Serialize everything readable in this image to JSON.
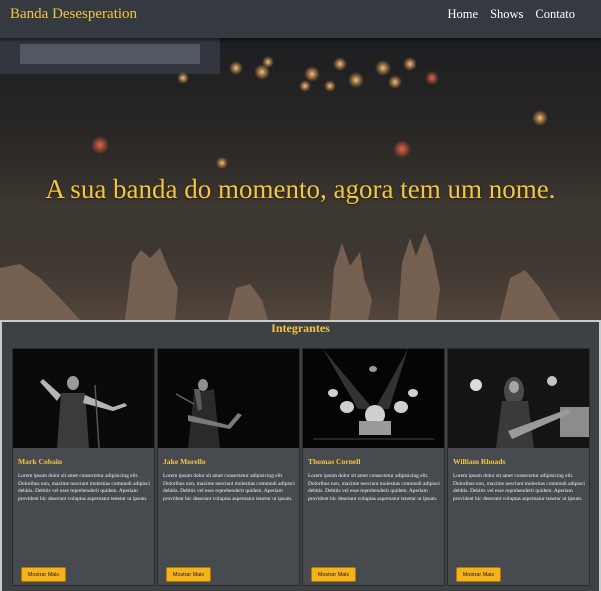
{
  "navbar": {
    "brand": "Banda Desesperation",
    "links": [
      "Home",
      "Shows",
      "Contato"
    ]
  },
  "hero": {
    "title": "A sua banda do momento, agora tem um nome."
  },
  "members": {
    "title": "Integrantes",
    "cards": [
      {
        "name": "Mark Cobain",
        "text": "Lorem ipsum dolor sit amet consectetur adipisicing elit. Doloribus non, maxime nesciunt molestias commodi adipisci debitis. Debitis vel esse reprehenderit quidem. Aperiam provident hic deserunt voluptas aspernatur tenetur ut ipsum.",
        "button": "Mostrar Mais"
      },
      {
        "name": "Jake Morello",
        "text": "Lorem ipsum dolor sit amet consectetur adipisicing elit. Doloribus non, maxime nesciunt molestias commodi adipisci debitis. Debitis vel esse reprehenderit quidem. Aperiam provident hic deserunt voluptas aspernatur tenetur ut ipsum.",
        "button": "Mostrar Mais"
      },
      {
        "name": "Thomas Cornell",
        "text": "Lorem ipsum dolor sit amet consectetur adipisicing elit. Doloribus non, maxime nesciunt molestias commodi adipisci debitis. Debitis vel esse reprehenderit quidem. Aperiam provident hic deserunt voluptas aspernatur tenetur ut ipsum.",
        "button": "Mostrar Mais"
      },
      {
        "name": "William Rhoads",
        "text": "Lorem ipsum dolor sit amet consectetur adipisicing elit. Doloribus non, maxime nesciunt molestias commodi adipisci debitis. Debitis vel esse reprehenderit quidem. Aperiam provident hic deserunt voluptas aspernatur tenetur ut ipsum.",
        "button": "Mostrar Mais"
      }
    ]
  },
  "colors": {
    "accent": "#f4c542",
    "navbar_bg": "#343a40",
    "page_bg": "#3d4144",
    "card_bg": "#474b50",
    "button_bg": "#f6b21a"
  }
}
